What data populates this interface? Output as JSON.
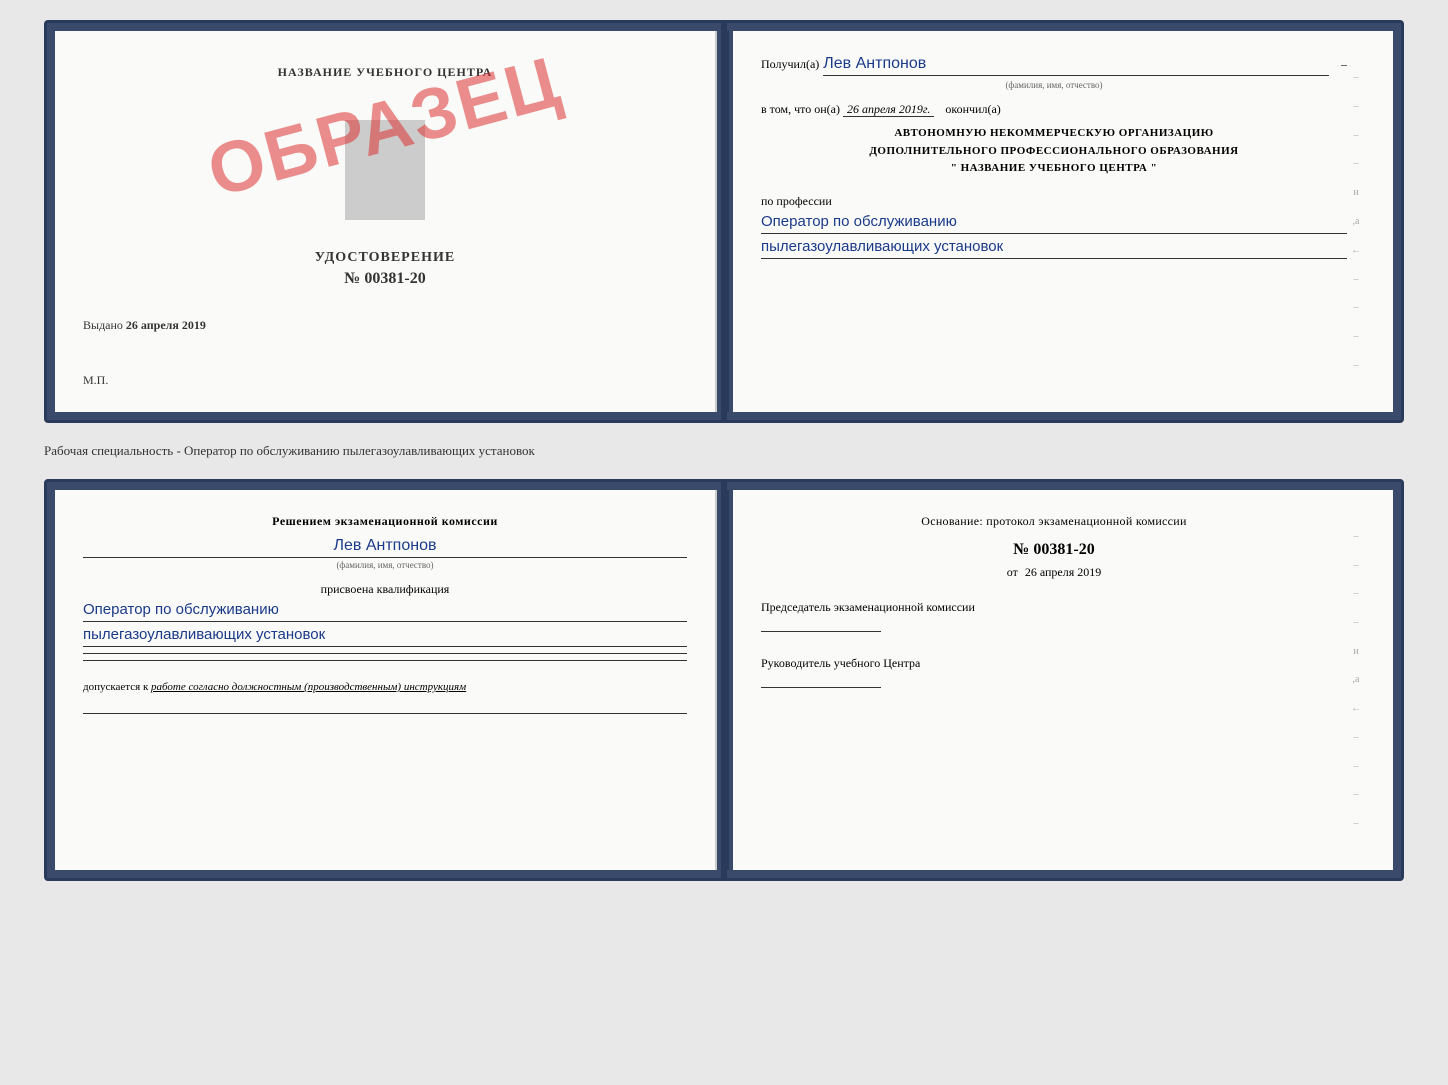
{
  "top_book": {
    "left_page": {
      "title": "НАЗВАНИЕ УЧЕБНОГО ЦЕНТРА",
      "stamp": "ОБРАЗЕЦ",
      "udostoverenie_label": "УДОСТОВЕРЕНИЕ",
      "number": "№ 00381-20",
      "vydano_label": "Выдано",
      "vydano_date": "26 апреля 2019",
      "mp_label": "М.П."
    },
    "right_page": {
      "poluchil_label": "Получил(а)",
      "poluchil_name": "Лев Антпонов",
      "fio_subtitle": "(фамилия, имя, отчество)",
      "dash": "–",
      "vtom_label": "в том, что он(а)",
      "vtom_date": "26 апреля 2019г.",
      "okonchil_label": "окончил(а)",
      "org_line1": "АВТОНОМНУЮ НЕКОММЕРЧЕСКУЮ ОРГАНИЗАЦИЮ",
      "org_line2": "ДОПОЛНИТЕЛЬНОГО ПРОФЕССИОНАЛЬНОГО ОБРАЗОВАНИЯ",
      "org_line3": "\"   НАЗВАНИЕ УЧЕБНОГО ЦЕНТРА   \"",
      "po_professii_label": "по профессии",
      "profession_line1": "Оператор по обслуживанию",
      "profession_line2": "пылегазоулавливающих установок"
    },
    "right_decorations": [
      "–",
      "–",
      "–",
      "–",
      "и",
      ",а",
      "←",
      "–",
      "–",
      "–",
      "–"
    ]
  },
  "separator": {
    "text": "Рабочая специальность - Оператор по обслуживанию пылегазоулавливающих установок"
  },
  "bottom_book": {
    "left_page": {
      "resheniyem_label": "Решением экзаменационной комиссии",
      "komissia_name": "Лев Антпонов",
      "fio_subtitle": "(фамилия, имя, отчество)",
      "prisvoena_label": "присвоена квалификация",
      "kvalif_line1": "Оператор по обслуживанию",
      "kvalif_line2": "пылегазоулавливающих установок",
      "dopusk_label": "допускается к",
      "dopusk_text": "работе согласно должностным (производственным) инструкциям"
    },
    "right_page": {
      "osnovanie_label": "Основание: протокол экзаменационной комиссии",
      "number": "№ 00381-20",
      "ot_label": "от",
      "date": "26 апреля 2019",
      "predsedatel_label": "Председатель экзаменационной комиссии",
      "rukovoditel_label": "Руководитель учебного Центра"
    },
    "right_decorations": [
      "–",
      "–",
      "–",
      "–",
      "и",
      ",а",
      "←",
      "–",
      "–",
      "–",
      "–"
    ]
  }
}
